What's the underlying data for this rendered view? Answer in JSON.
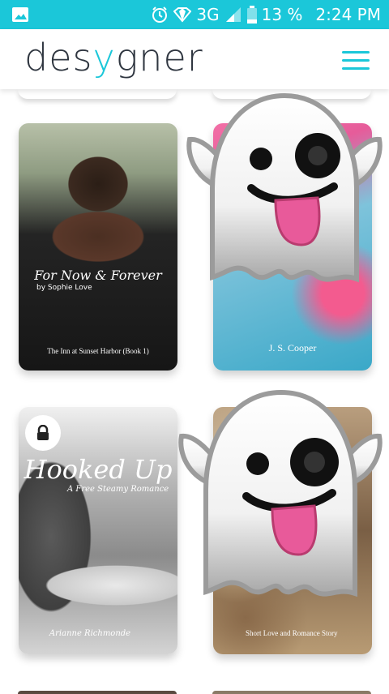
{
  "status_bar": {
    "network": "3G",
    "battery": "13 %",
    "time": "2:24 PM"
  },
  "header": {
    "logo_start": "des",
    "logo_accent": "y",
    "logo_end": "gner"
  },
  "books": [
    {
      "title": "For Now & Forever",
      "author": "by Sophie Love",
      "series": "The Inn at Sunset Harbor (Book 1)"
    },
    {
      "author": "J. S. Cooper"
    },
    {
      "title": "Hooked Up",
      "subtitle": "A Free Steamy Romance",
      "author": "Arianne Richmonde",
      "locked": true
    },
    {
      "tagline": "Short Love and Romance Story"
    }
  ],
  "colors": {
    "accent": "#1bc7d9",
    "logo_text": "#2f3640"
  },
  "icons": [
    "image-icon",
    "alarm-icon",
    "wifi-icon",
    "signal-icon",
    "battery-icon",
    "menu-icon",
    "lock-icon",
    "ghost-icon"
  ]
}
